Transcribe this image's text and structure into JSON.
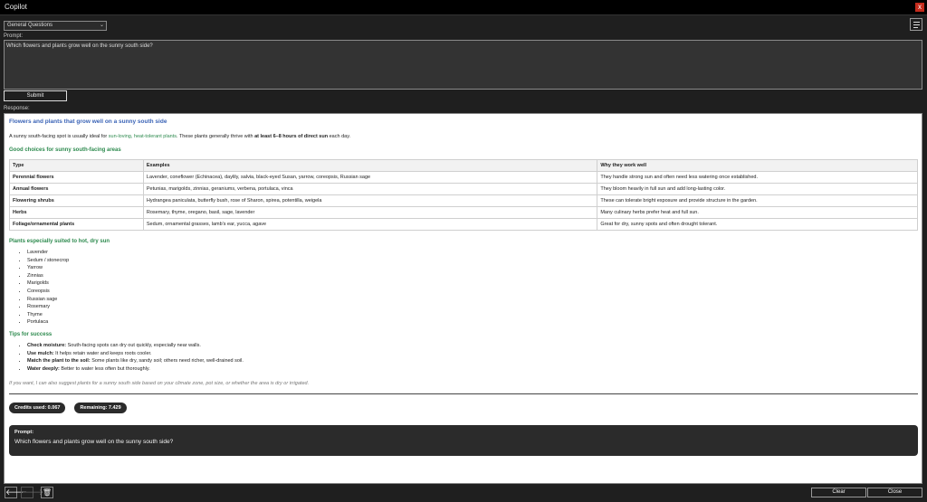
{
  "window": {
    "title": "Copilot",
    "close_glyph": "x"
  },
  "mode_select": {
    "value": "General Questions",
    "chevron": "⌄"
  },
  "prompt": {
    "label": "Prompt:",
    "value": "Which flowers and plants grow well on the sunny south side?"
  },
  "submit_label": "Submit",
  "response": {
    "label": "Response:",
    "heading": "Flowers and plants that grow well on a sunny south side",
    "intro_prefix": "A sunny south-facing spot is usually ideal for ",
    "intro_highlight": "sun-loving, heat-tolerant plants",
    "intro_mid": ". These plants generally thrive with ",
    "intro_bold": "at least 6–8 hours of direct sun",
    "intro_suffix": " each day.",
    "choices_heading": "Good choices for sunny south-facing areas",
    "table": {
      "headers": [
        "Type",
        "Examples",
        "Why they work well"
      ],
      "rows": [
        [
          "Perennial flowers",
          "Lavender, coneflower (Echinacea), daylily, salvia, black-eyed Susan, yarrow, coreopsis, Russian sage",
          "They handle strong sun and often need less watering once established."
        ],
        [
          "Annual flowers",
          "Petunias, marigolds, zinnias, geraniums, verbena, portulaca, vinca",
          "They bloom heavily in full sun and add long-lasting color."
        ],
        [
          "Flowering shrubs",
          "Hydrangea paniculata, butterfly bush, rose of Sharon, spirea, potentilla, weigela",
          "These can tolerate bright exposure and provide structure in the garden."
        ],
        [
          "Herbs",
          "Rosemary, thyme, oregano, basil, sage, lavender",
          "Many culinary herbs prefer heat and full sun."
        ],
        [
          "Foliage/ornamental plants",
          "Sedum, ornamental grasses, lamb's ear, yucca, agave",
          "Great for dry, sunny spots and often drought tolerant."
        ]
      ]
    },
    "hot_heading": "Plants especially suited to hot, dry sun",
    "hot_list": [
      "Lavender",
      "Sedum / stonecrop",
      "Yarrow",
      "Zinnias",
      "Marigolds",
      "Coreopsis",
      "Russian sage",
      "Rosemary",
      "Thyme",
      "Portulaca"
    ],
    "tips_heading": "Tips for success",
    "tips": [
      {
        "bold": "Check moisture:",
        "text": " South-facing spots can dry out quickly, especially near walls."
      },
      {
        "bold": "Use mulch:",
        "text": " It helps retain water and keeps roots cooler."
      },
      {
        "bold": "Match the plant to the soil:",
        "text": " Some plants like dry, sandy soil; others need richer, well-drained soil."
      },
      {
        "bold": "Water deeply:",
        "text": " Better to water less often but thoroughly."
      }
    ],
    "followup": "If you want, I can also suggest plants for a sunny south side based on your climate zone, pot size, or whether the area is dry or irrigated.",
    "credits_used": "Credits used: 0.067",
    "remaining": "Remaining: 7.429",
    "prompt_card_label": "Prompt:",
    "prompt_card_text": "Which flowers and plants grow well on the sunny south side?"
  },
  "footer": {
    "back_icon": "🡐",
    "forward_icon": "🡒",
    "trash_icon": "🗑",
    "clear_label": "Clear",
    "close_label": "Close"
  }
}
